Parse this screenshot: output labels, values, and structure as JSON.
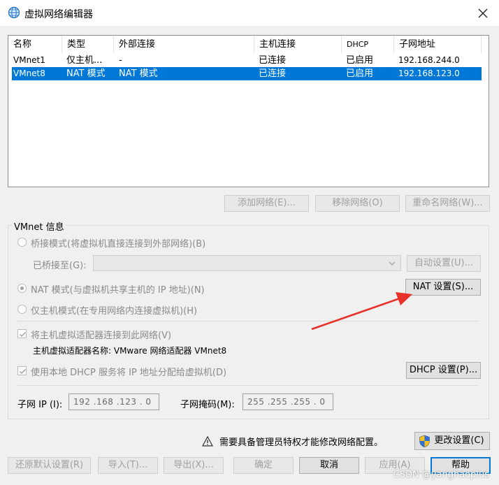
{
  "window": {
    "title": "虚拟网络编辑器",
    "close": "✕"
  },
  "table": {
    "headers": [
      "名称",
      "类型",
      "外部连接",
      "主机连接",
      "DHCP",
      "子网地址"
    ],
    "rows": [
      [
        "VMnet1",
        "仅主机...",
        "-",
        "已连接",
        "已启用",
        "192.168.244.0"
      ],
      [
        "VMnet8",
        "NAT 模式",
        "NAT 模式",
        "已连接",
        "已启用",
        "192.168.123.0"
      ]
    ],
    "selected_row": 1
  },
  "list_buttons": {
    "add": "添加网络(E)...",
    "remove": "移除网络(O)",
    "rename": "重命名网络(W)..."
  },
  "vmnet_info": {
    "group_title": "VMnet 信息",
    "bridge_mode": "桥接模式(将虚拟机直接连接到外部网络)(B)",
    "bridged_to_label": "已桥接至(G):",
    "auto_settings": "自动设置(U)...",
    "nat_mode": "NAT 模式(与虚拟机共享主机的 IP 地址)(N)",
    "nat_settings": "NAT 设置(S)...",
    "host_only_mode": "仅主机模式(在专用网络内连接虚拟机)(H)",
    "connect_adapter": "将主机虚拟适配器连接到此网络(V)",
    "adapter_name": "主机虚拟适配器名称: VMware 网络适配器 VMnet8",
    "use_dhcp": "使用本地 DHCP 服务将 IP 地址分配给虚拟机(D)",
    "dhcp_settings": "DHCP 设置(P)...",
    "subnet_ip_label": "子网 IP (I):",
    "subnet_ip_value": "192 .168 .123 . 0",
    "subnet_mask_label": "子网掩码(M):",
    "subnet_mask_value": "255 .255 .255 . 0",
    "selected_mode": "nat",
    "connect_adapter_checked": true,
    "use_dhcp_checked": true
  },
  "admin": {
    "warning": "需要具备管理员特权才能修改网络配置。",
    "change_settings": "更改设置(C)"
  },
  "footer": {
    "restore": "还原默认设置(R)",
    "import": "导入(T)...",
    "export": "导出(X)...",
    "ok": "确定",
    "cancel": "取消",
    "apply": "应用(A)",
    "help": "帮助"
  },
  "watermark": "CSDN @yanghaoplus",
  "colors": {
    "selection": "#0078d7",
    "annotation_arrow": "#e8312a",
    "shield_blue": "#2f6fd6",
    "shield_yellow": "#f3c220"
  },
  "icons": [
    "globe-network-icon",
    "close-icon",
    "warning-icon",
    "uac-shield-icon",
    "chevron-down-icon",
    "checkmark-icon"
  ]
}
